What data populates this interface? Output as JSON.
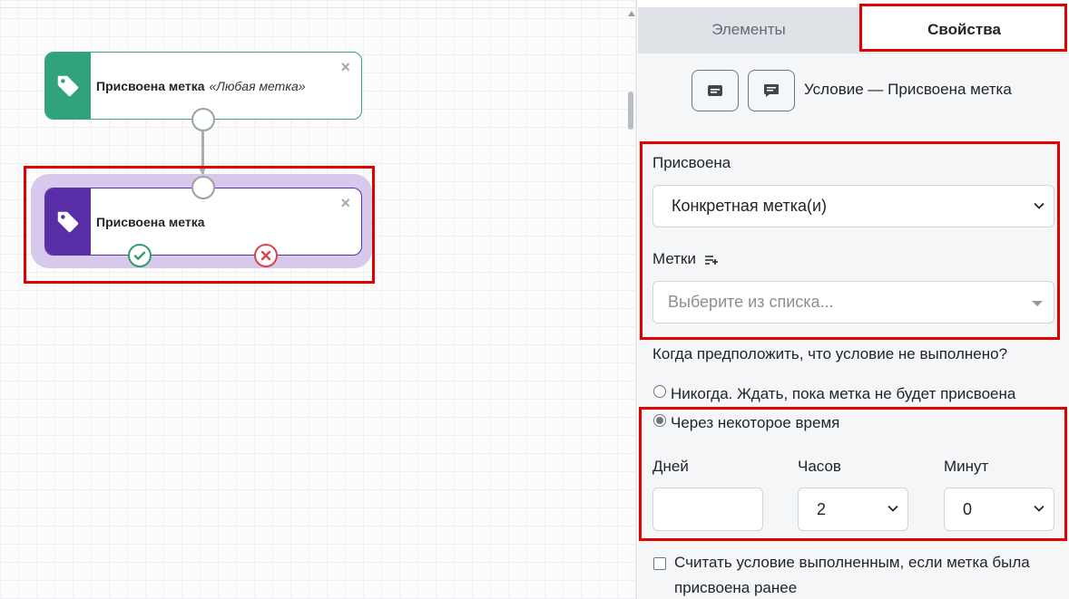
{
  "canvas": {
    "nodes": [
      {
        "title": "Присвоена метка",
        "subtitle": "«Любая метка»",
        "close": "×",
        "icon": "tag-icon",
        "color": "#31a37a"
      },
      {
        "title": "Присвоена метка",
        "subtitle": "",
        "close": "×",
        "icon": "tag-icon",
        "color": "#5a2ea6"
      }
    ],
    "badges": {
      "ok_icon": "check-icon",
      "ok_color": "#2e9e6b",
      "fail_icon": "cross-icon",
      "fail_color": "#d9444b"
    }
  },
  "panel": {
    "tabs": [
      {
        "label": "Элементы",
        "active": false
      },
      {
        "label": "Свойства",
        "active": true
      }
    ],
    "toolbar": {
      "icons": [
        "card-icon",
        "comment-icon"
      ]
    },
    "condition_title": "Условие — Присвоена метка",
    "assigned": {
      "label": "Присвоена",
      "value": "Конкретная метка(и)"
    },
    "tags": {
      "label": "Метки",
      "icon": "list-add-icon",
      "placeholder": "Выберите из списка..."
    },
    "when_question": "Когда предположить, что условие не выполнено?",
    "radio_never": {
      "label": "Никогда. Ждать, пока метка не будет присвоена",
      "checked": false
    },
    "radio_after": {
      "label": "Через некоторое время",
      "checked": true
    },
    "delay": {
      "days_label": "Днeй",
      "days_value": "",
      "hours_label": "Часов",
      "hours_value": "2",
      "minutes_label": "Минут",
      "minutes_value": "0"
    },
    "checkbox_prior": {
      "line1": "Считать условие выполненным, если метка была",
      "line2": "присвоена ранее",
      "checked": false
    }
  },
  "highlight_color": "#e00000"
}
